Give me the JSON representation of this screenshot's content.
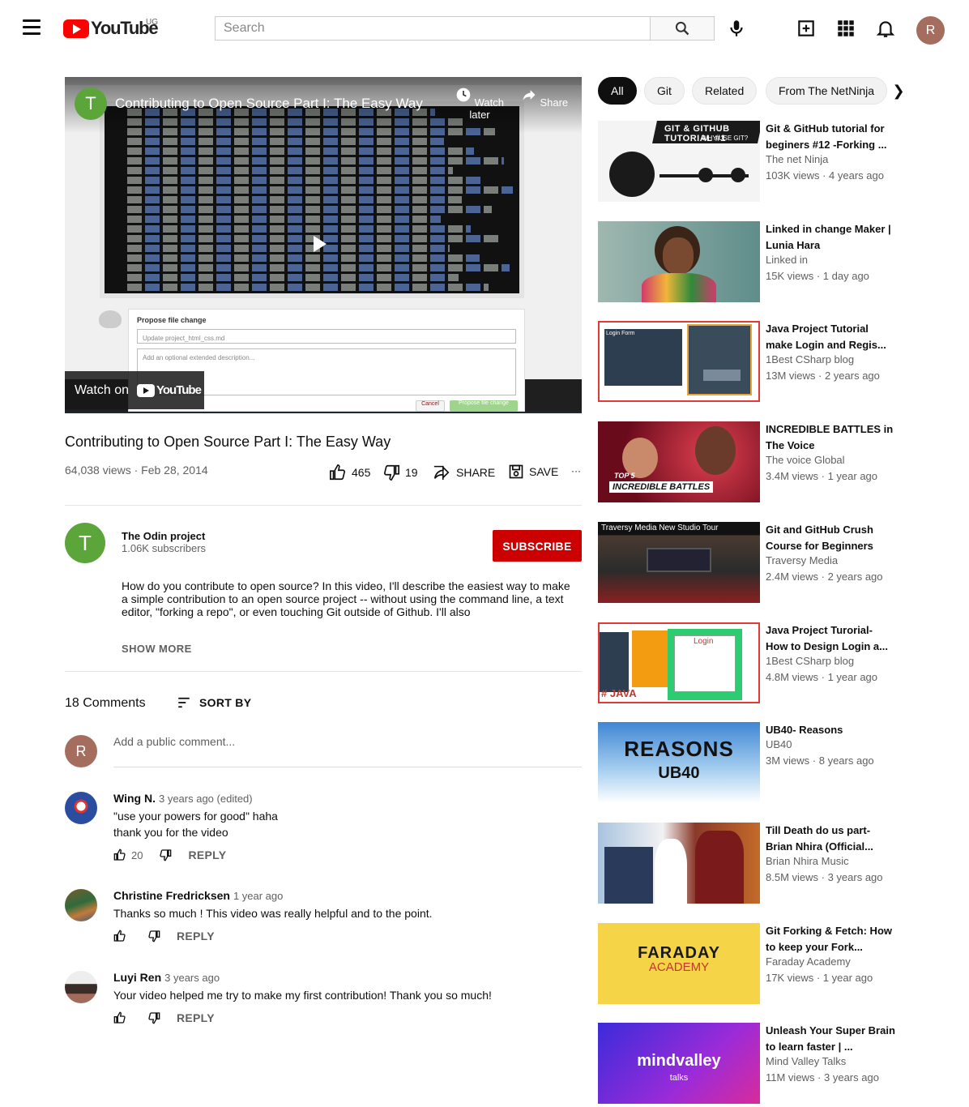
{
  "header": {
    "logo_text": "YouTube",
    "country": "UG",
    "search_placeholder": "Search",
    "avatar_letter": "R"
  },
  "player": {
    "channel_letter": "T",
    "title": "Contributing to Open Source Part I: The Easy Way",
    "watch_later": "Watch later",
    "share": "Share",
    "watch_on": "Watch on",
    "yt_text": "YouTube",
    "form_title": "Propose file change",
    "form_input": "Update project_html_css.md",
    "form_area": "Add an optional extended description...",
    "cancel": "Cancel",
    "propose": "Propose file change"
  },
  "video": {
    "title": "Contributing to Open Source Part I: The Easy Way",
    "meta": "64,038 views · Feb 28, 2014",
    "likes": "465",
    "dislikes": "19",
    "share": "SHARE",
    "save": "SAVE",
    "more": "···"
  },
  "owner": {
    "letter": "T",
    "name": "The Odin project",
    "subscribers": "1.06K subscribers",
    "subscribe": "SUBSCRIBE",
    "description": "How do you contribute to open source? In this video, I'll describe the easiest way to make a simple contribution to an open source project -- without using the command line, a text editor, \"forking a repo\", or even touching Git outside of Github. I'll also",
    "show_more": "SHOW MORE"
  },
  "comments": {
    "count": "18 Comments",
    "sort_by": "SORT BY",
    "my_letter": "R",
    "placeholder": "Add a public comment...",
    "items": [
      {
        "author": "Wing N.",
        "time": "3 years ago (edited)",
        "lines": [
          "\"use your powers for good\" haha",
          "thank you for the video"
        ],
        "likes": "20",
        "reply": "REPLY"
      },
      {
        "author": "Christine Fredricksen",
        "time": "1 year ago",
        "lines": [
          "Thanks so much ! This video was really helpful and to the point."
        ],
        "likes": "",
        "reply": "REPLY"
      },
      {
        "author": "Luyi Ren",
        "time": "3 years ago",
        "lines": [
          "Your video helped me try to make my first contribution! Thank you so much!"
        ],
        "likes": "",
        "reply": "REPLY"
      }
    ]
  },
  "chips": [
    "All",
    "Git",
    "Related",
    "From The NetNinja"
  ],
  "recommendations": [
    {
      "title": "Git & GitHub tutorial for beginers #12 -Forking ...",
      "channel": "The net Ninja",
      "stats": "103K views · 4 years ago",
      "thumb_text": "GIT & GITHUB TUTORIAL #1",
      "thumb_sub": "WHY USE GIT?",
      "accent": "#1a1a1a"
    },
    {
      "title": "Linked in change Maker | Lunia Hara",
      "channel": "Linked in",
      "stats": "15K views · 1 day ago",
      "thumb_text": "",
      "thumb_sub": "",
      "accent": "#5f8d8a"
    },
    {
      "title": "Java Project Tutorial make Login and Regis...",
      "channel": "1Best CSharp blog",
      "stats": "13M views · 2 years ago",
      "thumb_text": "Login Form",
      "thumb_sub": "",
      "accent": "#e53935"
    },
    {
      "title": "INCREDIBLE BATTLES in The Voice",
      "channel": "The voice Global",
      "stats": "3.4M views · 1 year ago",
      "thumb_text": "INCREDIBLE BATTLES",
      "thumb_sub": "TOP 5",
      "accent": "#b3122b"
    },
    {
      "title": "Git and GitHub Crush Course for Beginners",
      "channel": "Traversy Media",
      "stats": "2.4M views · 2 years ago",
      "thumb_text": "Traversy Media New Studio Tour",
      "thumb_sub": "",
      "accent": "#2b2b2b"
    },
    {
      "title": "Java Project Turorial- How to Design Login a...",
      "channel": "1Best CSharp blog",
      "stats": "4.8M views · 1 year ago",
      "thumb_text": "Login",
      "thumb_sub": "# JAVA",
      "accent": "#e53935"
    },
    {
      "title": "UB40- Reasons",
      "channel": "UB40",
      "stats": "3M views · 8 years ago",
      "thumb_text": "REASONS",
      "thumb_sub": "UB40",
      "accent": "#4a90d9"
    },
    {
      "title": "Till Death do us part-Brian Nhira (Official...",
      "channel": "Brian Nhira Music",
      "stats": "8.5M views · 3 years ago",
      "thumb_text": "",
      "thumb_sub": "",
      "accent": "#4a6fa5"
    },
    {
      "title": "Git Forking & Fetch: How to keep your Fork...",
      "channel": "Faraday Academy",
      "stats": "17K views · 1 year ago",
      "thumb_text": "FARADAY",
      "thumb_sub": "ACADEMY",
      "accent": "#f5d547"
    },
    {
      "title": "Unleash Your Super Brain to learn faster | ...",
      "channel": "Mind Valley Talks",
      "stats": "11M views · 3 years ago",
      "thumb_text": "mindvalley",
      "thumb_sub": "talks",
      "accent": "#6a2bd9"
    }
  ]
}
